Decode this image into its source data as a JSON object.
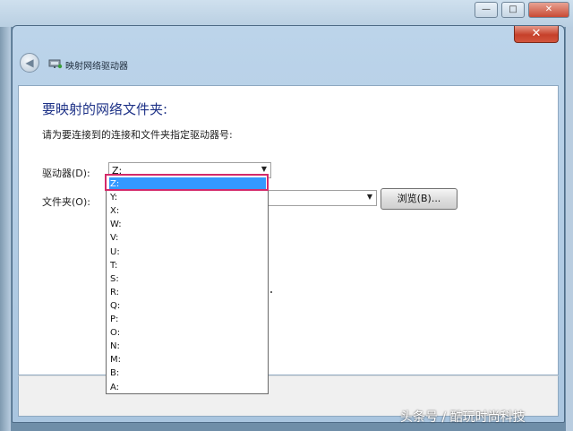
{
  "dialog": {
    "title": "映射网络驱动器",
    "close_label": "✕",
    "back_label": "◀"
  },
  "background_window": {
    "minimize_label": "—",
    "maximize_label": "□",
    "close_label": "✕"
  },
  "content": {
    "heading": "要映射的网络文件夹:",
    "instruction": "请为要连接到的连接和文件夹指定驱动器号:",
    "drive_label": "驱动器(D):",
    "drive_value": "Z:",
    "folder_label": "文件夹(O):",
    "folder_value": "",
    "browse_label": "浏览(B)..."
  },
  "drive_options": [
    "Z:",
    "Y:",
    "X:",
    "W:",
    "V:",
    "U:",
    "T:",
    "S:",
    "R:",
    "Q:",
    "P:",
    "O:",
    "N:",
    "M:",
    "B:",
    "A:"
  ],
  "selected_option": "Z:",
  "watermark": "头条号 / 酷玩时尚科技",
  "colors": {
    "selection": "#3399ff",
    "highlight_box": "#d42a6a",
    "heading": "#1e3287"
  }
}
